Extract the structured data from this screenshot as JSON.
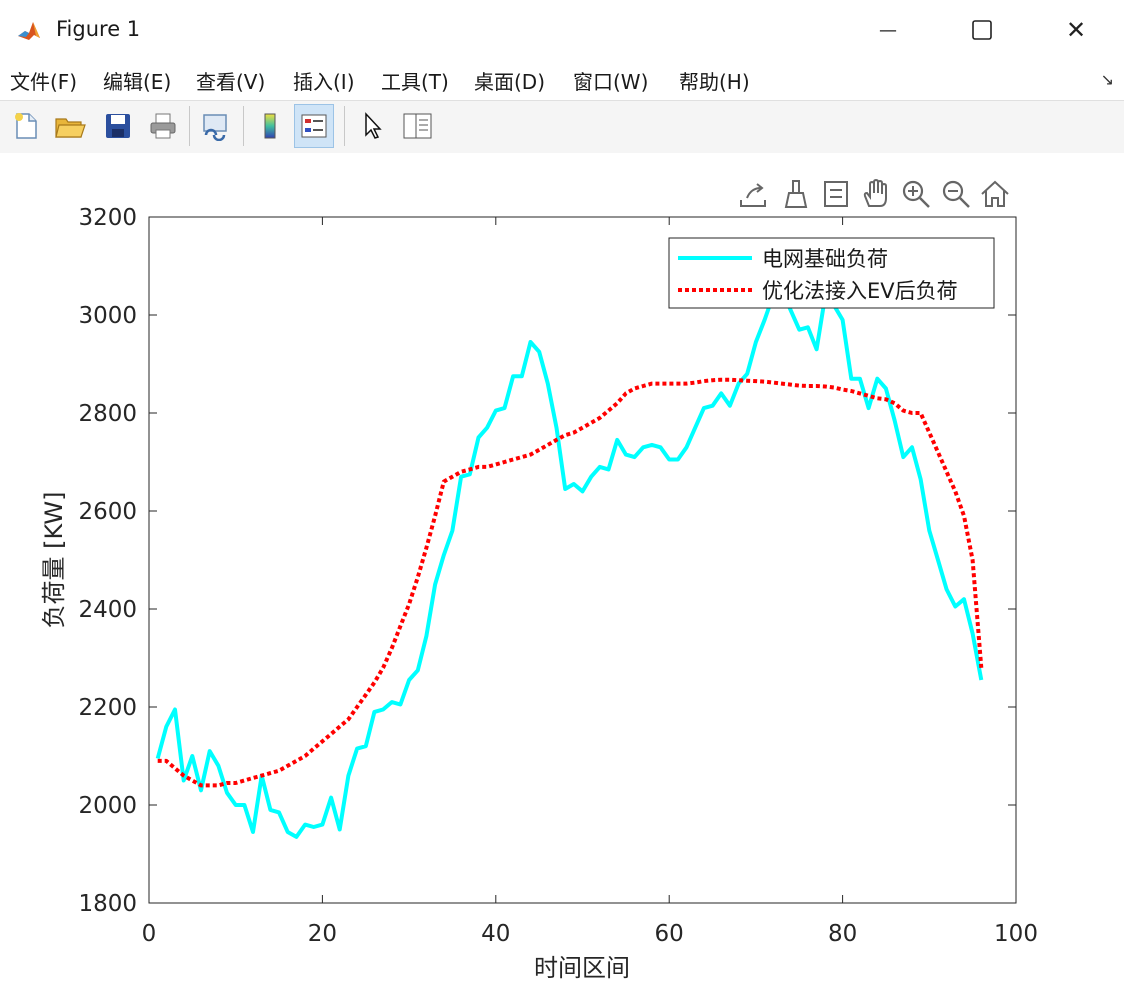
{
  "window": {
    "title": "Figure 1",
    "minimize_glyph": "—",
    "close_glyph": "✕"
  },
  "menu": {
    "items": [
      {
        "label": "文件(F)"
      },
      {
        "label": "编辑(E)"
      },
      {
        "label": "查看(V)"
      },
      {
        "label": "插入(I)"
      },
      {
        "label": "工具(T)"
      },
      {
        "label": "桌面(D)"
      },
      {
        "label": "窗口(W)"
      },
      {
        "label": "帮助(H)"
      }
    ],
    "overflow_glyph": "↘"
  },
  "toolbar": {
    "icons": [
      "new-figure-icon",
      "open-file-icon",
      "save-icon",
      "print-icon",
      "link-plot-icon",
      "insert-colorbar-icon",
      "insert-legend-icon",
      "edit-plot-icon",
      "property-inspector-icon"
    ]
  },
  "axes_toolbar": {
    "icons": [
      "export-icon",
      "brush-icon",
      "data-tips-icon",
      "pan-icon",
      "zoom-in-icon",
      "zoom-out-icon",
      "home-icon"
    ]
  },
  "colors": {
    "series1": "#00ffff",
    "series2": "#ff0000"
  },
  "chart_data": {
    "type": "line",
    "xlabel": "时间区间",
    "ylabel": "负荷量 [KW]",
    "xlim": [
      0,
      100
    ],
    "ylim": [
      1800,
      3200
    ],
    "xticks": [
      "0",
      "20",
      "40",
      "60",
      "80",
      "100"
    ],
    "yticks": [
      "1800",
      "2000",
      "2200",
      "2400",
      "2600",
      "2800",
      "3000",
      "3200"
    ],
    "grid": false,
    "legend_position": "top-right",
    "x": [
      1,
      2,
      3,
      4,
      5,
      6,
      7,
      8,
      9,
      10,
      11,
      12,
      13,
      14,
      15,
      16,
      17,
      18,
      19,
      20,
      21,
      22,
      23,
      24,
      25,
      26,
      27,
      28,
      29,
      30,
      31,
      32,
      33,
      34,
      35,
      36,
      37,
      38,
      39,
      40,
      41,
      42,
      43,
      44,
      45,
      46,
      47,
      48,
      49,
      50,
      51,
      52,
      53,
      54,
      55,
      56,
      57,
      58,
      59,
      60,
      61,
      62,
      63,
      64,
      65,
      66,
      67,
      68,
      69,
      70,
      71,
      72,
      73,
      74,
      75,
      76,
      77,
      78,
      79,
      80,
      81,
      82,
      83,
      84,
      85,
      86,
      87,
      88,
      89,
      90,
      91,
      92,
      93,
      94,
      95,
      96
    ],
    "series": [
      {
        "name": "电网基础负荷",
        "style": "solid",
        "values": [
          2095,
          2160,
          2195,
          2050,
          2100,
          2030,
          2110,
          2080,
          2025,
          2000,
          2000,
          1945,
          2060,
          1990,
          1985,
          1945,
          1935,
          1960,
          1955,
          1960,
          2015,
          1950,
          2060,
          2115,
          2120,
          2190,
          2195,
          2210,
          2205,
          2255,
          2275,
          2345,
          2450,
          2510,
          2560,
          2670,
          2675,
          2750,
          2770,
          2805,
          2810,
          2875,
          2875,
          2945,
          2925,
          2860,
          2770,
          2645,
          2655,
          2640,
          2670,
          2690,
          2685,
          2745,
          2715,
          2710,
          2730,
          2735,
          2730,
          2705,
          2705,
          2730,
          2770,
          2810,
          2815,
          2840,
          2815,
          2860,
          2880,
          2945,
          2990,
          3040,
          3050,
          3010,
          2970,
          2975,
          2930,
          3040,
          3020,
          2990,
          2870,
          2870,
          2810,
          2870,
          2850,
          2785,
          2710,
          2730,
          2665,
          2560,
          2500,
          2440,
          2405,
          2420,
          2350,
          2255
        ]
      },
      {
        "name": "优化法接入EV后负荷",
        "style": "dotted",
        "values": [
          2090,
          2090,
          2075,
          2060,
          2050,
          2040,
          2040,
          2040,
          2045,
          2045,
          2050,
          2055,
          2060,
          2065,
          2070,
          2080,
          2090,
          2100,
          2115,
          2130,
          2145,
          2160,
          2175,
          2200,
          2225,
          2250,
          2280,
          2320,
          2365,
          2410,
          2465,
          2525,
          2590,
          2660,
          2670,
          2680,
          2685,
          2690,
          2690,
          2695,
          2700,
          2705,
          2710,
          2715,
          2725,
          2735,
          2745,
          2755,
          2760,
          2770,
          2780,
          2790,
          2805,
          2820,
          2840,
          2850,
          2855,
          2860,
          2860,
          2860,
          2860,
          2860,
          2862,
          2865,
          2867,
          2868,
          2868,
          2867,
          2866,
          2865,
          2864,
          2862,
          2860,
          2858,
          2856,
          2855,
          2855,
          2854,
          2852,
          2848,
          2845,
          2840,
          2835,
          2830,
          2828,
          2820,
          2805,
          2800,
          2800,
          2760,
          2720,
          2680,
          2640,
          2590,
          2500,
          2280
        ]
      }
    ]
  }
}
